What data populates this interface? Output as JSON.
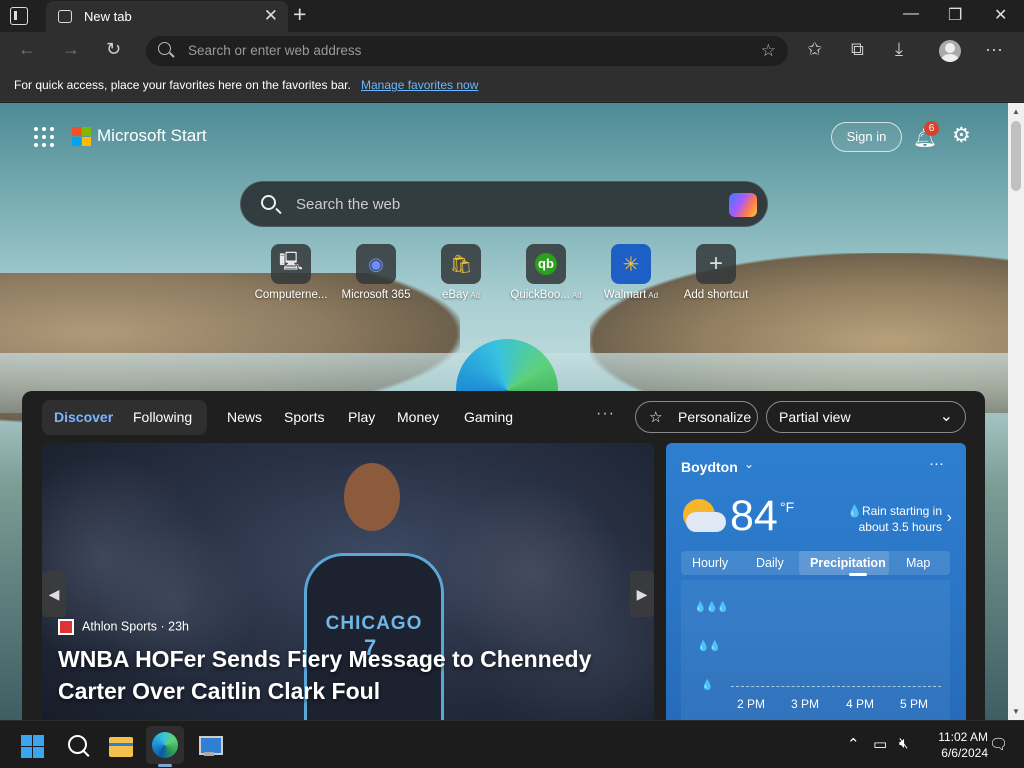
{
  "browser": {
    "tab_title": "New tab",
    "tab_close": "✕",
    "new_tab": "+",
    "window_controls": {
      "minimize": "—",
      "maximize": "❐",
      "close": "✕"
    },
    "address_placeholder": "Search or enter web address",
    "toolbar_icons": [
      "back-icon",
      "forward-icon",
      "refresh-icon",
      "favorites-icon",
      "collections-icon",
      "downloads-icon",
      "profile-icon",
      "more-icon"
    ]
  },
  "favorites_bar": {
    "message": "For quick access, place your favorites here on the favorites bar.",
    "link": "Manage favorites now"
  },
  "start": {
    "brand": "Microsoft Start",
    "sign_in": "Sign in",
    "notification_count": "6",
    "search_placeholder": "Search the web",
    "shortcuts": [
      {
        "label": "Computerne...",
        "ad": "",
        "glyph": "🖳",
        "color": "#e8e8e8"
      },
      {
        "label": "Microsoft 365",
        "ad": "",
        "glyph": "◉",
        "color": "#6d8cff"
      },
      {
        "label": "eBay",
        "ad": "Ad",
        "glyph": "🛍",
        "color": "#f5c63a"
      },
      {
        "label": "QuickBoo...",
        "ad": "Ad",
        "glyph": "qb",
        "color": "#2ca01c"
      },
      {
        "label": "Walmart",
        "ad": "Ad",
        "glyph": "✳",
        "color": "#ffc220"
      },
      {
        "label": "Add shortcut",
        "ad": "",
        "glyph": "+",
        "color": "#dddddd"
      }
    ]
  },
  "feed": {
    "tabs": {
      "discover": "Discover",
      "following": "Following"
    },
    "nav": [
      "News",
      "Sports",
      "Play",
      "Money",
      "Gaming"
    ],
    "more": "···",
    "personalize": "Personalize",
    "view": "Partial view",
    "hero": {
      "source": "Athlon Sports · 23h",
      "headline": "WNBA HOFer Sends Fiery Message to Chennedy Carter Over Caitlin Clark Foul",
      "jersey_team": "CHICAGO",
      "jersey_number": "7"
    }
  },
  "weather": {
    "location": "Boydton",
    "temperature": "84",
    "unit": "°F",
    "alert": "💧Rain starting in about 3.5 hours",
    "tabs": [
      "Hourly",
      "Daily",
      "Precipitation",
      "Map"
    ],
    "selected_tab": "Precipitation",
    "times": [
      "2 PM",
      "3 PM",
      "4 PM",
      "5 PM"
    ],
    "drop_levels": [
      "💧💧💧",
      "💧💧",
      "💧"
    ]
  },
  "taskbar": {
    "time": "11:02 AM",
    "date": "6/6/2024"
  }
}
